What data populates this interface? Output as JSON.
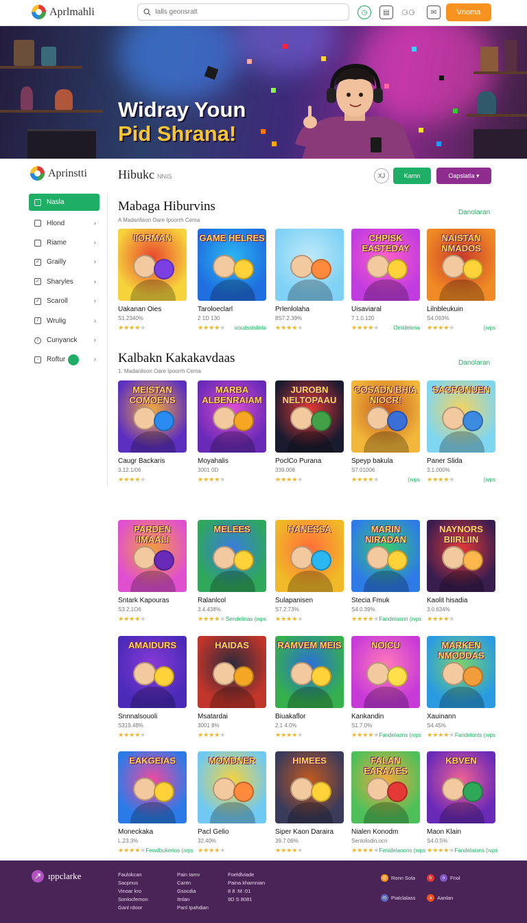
{
  "topbar": {
    "brand": "Aprlmahli",
    "search_placeholder": "Ialls geonsralt",
    "cta": "Vnoma"
  },
  "hero": {
    "line1": "Widray Youn",
    "line2": "Pid Shrana!"
  },
  "header": {
    "brand": "Aprinstti",
    "title": "Hibukc",
    "subtitle": "NNIS",
    "circle_icon": "XJ",
    "green_btn": "Kamn",
    "purple_btn": "Oapslatla"
  },
  "sidebar": {
    "items": [
      {
        "label": "Nasla",
        "active": true
      },
      {
        "label": "Hlond"
      },
      {
        "label": "Riame"
      },
      {
        "label": "Grailly"
      },
      {
        "label": "Sharyles"
      },
      {
        "label": "Scaroll"
      },
      {
        "label": "Wrulig"
      },
      {
        "label": "Cunyanck"
      },
      {
        "label": "Roftur"
      }
    ]
  },
  "sections": [
    {
      "title": "Mabaga Hiburvins",
      "subtitle": "A Madanlison Oare  Ipoorrh Cema",
      "more": "Danolaran"
    },
    {
      "title": "Kalbakn Kakakavdaas",
      "subtitle": "1. Madanlison Oare  Ipoorrh Cema",
      "more": "Danolaran"
    }
  ],
  "cards": [
    {
      "title": "Uakanan Oies",
      "meta": "S1.2340%",
      "tag": "",
      "art": "IIORMAN"
    },
    {
      "title": "Taroloeclarl",
      "meta": "2 1D 130",
      "tag": "ooudsstslinla",
      "art": "GAME HELRES"
    },
    {
      "title": "Prlenlolaha",
      "meta": "8S7.2.39%",
      "tag": "",
      "art": ""
    },
    {
      "title": "Uisaviaral",
      "meta": "7 1.0.120",
      "tag": "Omldelena",
      "art": "CHPISK EASTEDAY"
    },
    {
      "title": "Lilnbleukuin",
      "meta": "S4.093%",
      "tag": "(ıvps",
      "art": "NAISTAN NMADOS"
    },
    {
      "title": "Caugr Backaris",
      "meta": "3.12.1/06",
      "tag": "",
      "art": "MEISTAN COMOENS"
    },
    {
      "title": "Moyahalis",
      "meta": "3001 0D",
      "tag": "",
      "art": "MARBA ALBENRAIAM"
    },
    {
      "title": "PoclCo Purana",
      "meta": "339.008",
      "tag": "",
      "art": "JUROBN NELTOPAAU"
    },
    {
      "title": "Speyp bakula",
      "meta": "S7.01006",
      "tag": "(ıvps",
      "art": "COSADN BHIA NIOCR!"
    },
    {
      "title": "Paner Slida",
      "meta": "3.1.000%",
      "tag": "(ıvps",
      "art": "SACRONUEN"
    },
    {
      "title": "Sntark Kapouras",
      "meta": "S3.2.1O6",
      "tag": "",
      "art": "PARDEN IIMAALI"
    },
    {
      "title": "Ralanlcol",
      "meta": "3.4.438%",
      "tag": "Sendelinas  (ıvps",
      "art": "MELEES"
    },
    {
      "title": "Sulapanisen",
      "meta": "S7.2.73%",
      "tag": "",
      "art": "HANESSA"
    },
    {
      "title": "Stecia Fmuk",
      "meta": "S4.0.39%",
      "tag": "Fandelaonn  (ıvps",
      "art": "MARIN NIRADAN"
    },
    {
      "title": "Kaolit hisadia",
      "meta": "3.0.634%",
      "tag": "",
      "art": "NAYNORS BIIRLIIN"
    },
    {
      "title": "Snnnalsouoli",
      "meta": "S319.48%",
      "tag": "",
      "art": "AMAIDURS"
    },
    {
      "title": "Msatardai",
      "meta": "3001 8%",
      "tag": "",
      "art": "HAIDAS"
    },
    {
      "title": "Biuakaflor",
      "meta": "2.1 4.0%",
      "tag": "",
      "art": "RAMVEM MEIS"
    },
    {
      "title": "Kankandin",
      "meta": "S1.7.0%",
      "tag": "Fandelaons  (ıvps",
      "art": "NOICU"
    },
    {
      "title": "Xauinann",
      "meta": "S4.45%",
      "tag": "Fandelonts  (ıvps",
      "art": "MARKEN NMODDAS"
    },
    {
      "title": "Moneckaka",
      "meta": "L.23.3%",
      "tag": "Fewdbukerios  (ıvps",
      "art": "EAKGEIAS"
    },
    {
      "title": "Pacl Gelio",
      "meta": "32.40%",
      "tag": "",
      "art": "MOMDNER"
    },
    {
      "title": "Siper Kaon Daraira",
      "meta": "39.7.06%",
      "tag": "",
      "art": "HIMEES"
    },
    {
      "title": "Nialen Konodm",
      "meta": "Senlolodin.ocn",
      "tag": "Fenidelaoons  (ıvps",
      "art": "FALAN EARAAES"
    },
    {
      "title": "Maon Klain",
      "meta": "S4.0.5%",
      "tag": "Fandelaions  (ıvps",
      "art": "KBVEN"
    }
  ],
  "footer": {
    "brand": "ıppclarke",
    "col1": [
      "Faulokcan",
      "Sacpnus",
      "Vinoar kro",
      "Sonlocfemon",
      "Ganl rdoor"
    ],
    "col2": [
      "Pain Iamv",
      "Cantn",
      "Gsocdia",
      "Itnlan",
      "Panl Ipahdian"
    ],
    "col3": [
      "Foeldlviade",
      "Paina kharnnian",
      "8 8 :M :01",
      "9D S 8081"
    ],
    "social": [
      {
        "label": "Ronn Sola",
        "icon": "@"
      },
      {
        "label": "b",
        "icon": "b"
      },
      {
        "label": "Fnol",
        "icon": "n"
      },
      {
        "label": "Pialclalass",
        "icon": "m"
      },
      {
        "label": "Aanlan",
        "icon": "a"
      }
    ]
  },
  "colors": {
    "accent_green": "#1fae66",
    "accent_purple": "#8e2d8e",
    "accent_orange": "#f7931e",
    "footer_bg": "#4a2456"
  }
}
